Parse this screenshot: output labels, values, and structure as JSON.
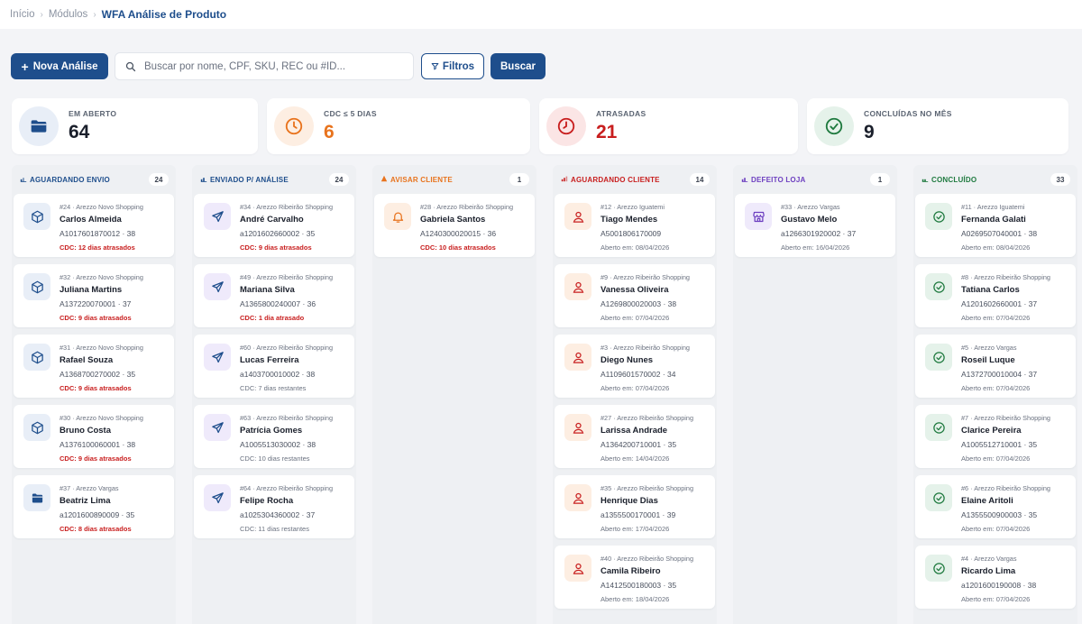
{
  "breadcrumb": {
    "home": "Início",
    "modules": "Módulos",
    "current": "WFA Análise de Produto"
  },
  "toolbar": {
    "new_label": "Nova Análise",
    "search_placeholder": "Buscar por nome, CPF, SKU, REC ou #ID...",
    "filters_label": "Filtros",
    "search_button": "Buscar"
  },
  "stats": [
    {
      "label": "EM ABERTO",
      "value": "64",
      "icon": "folder-icon",
      "color": "#1e4e8c",
      "bg": "#e8eef7"
    },
    {
      "label": "CDC ≤ 5 DIAS",
      "value": "6",
      "icon": "clock-icon",
      "color": "#e8731d",
      "bg": "#fdeee2"
    },
    {
      "label": "ATRASADAS",
      "value": "21",
      "icon": "alarm-icon",
      "color": "#c81e1e",
      "bg": "#fbe5e5"
    },
    {
      "label": "CONCLUÍDAS NO MÊS",
      "value": "9",
      "icon": "check-circle-icon",
      "color": "#1f7a3f",
      "bg": "#e5f2ea"
    }
  ],
  "columns": [
    {
      "title": "AGUARDANDO ENVIO",
      "count": "24",
      "color": "#1e4e8c",
      "icon_bg": "#e8eef7",
      "cards": [
        {
          "meta": "#24 · Arezzo Novo Shopping",
          "name": "Carlos Almeida",
          "code": "A1017601870012 · 38",
          "footer": "CDC: 12 dias atrasados",
          "footer_type": "danger",
          "icon": "box-icon"
        },
        {
          "meta": "#32 · Arezzo Novo Shopping",
          "name": "Juliana Martins",
          "code": "A137220070001 · 37",
          "footer": "CDC: 9 dias atrasados",
          "footer_type": "danger",
          "icon": "box-icon"
        },
        {
          "meta": "#31 · Arezzo Novo Shopping",
          "name": "Rafael Souza",
          "code": "A1368700270002 · 35",
          "footer": "CDC: 9 dias atrasados",
          "footer_type": "danger",
          "icon": "box-icon"
        },
        {
          "meta": "#30 · Arezzo Novo Shopping",
          "name": "Bruno Costa",
          "code": "A1376100060001 · 38",
          "footer": "CDC: 9 dias atrasados",
          "footer_type": "danger",
          "icon": "box-icon"
        },
        {
          "meta": "#37 · Arezzo Vargas",
          "name": "Beatriz Lima",
          "code": "a1201600890009 · 35",
          "footer": "CDC: 8 dias atrasados",
          "footer_type": "danger",
          "icon": "store-icon"
        }
      ]
    },
    {
      "title": "ENVIADO P/ ANÁLISE",
      "count": "24",
      "color": "#1e4e8c",
      "icon_bg": "#efeafb",
      "cards": [
        {
          "meta": "#34 · Arezzo Ribeirão Shopping",
          "name": "André Carvalho",
          "code": "a1201602660002 · 35",
          "footer": "CDC: 9 dias atrasados",
          "footer_type": "danger",
          "icon": "send-icon"
        },
        {
          "meta": "#49 · Arezzo Ribeirão Shopping",
          "name": "Mariana Silva",
          "code": "A1365800240007 · 36",
          "footer": "CDC: 1 dia atrasado",
          "footer_type": "danger",
          "icon": "send-icon"
        },
        {
          "meta": "#60 · Arezzo Ribeirão Shopping",
          "name": "Lucas Ferreira",
          "code": "a1403700010002 · 38",
          "footer": "CDC: 7 dias restantes",
          "footer_type": "muted",
          "icon": "send-icon"
        },
        {
          "meta": "#63 · Arezzo Ribeirão Shopping",
          "name": "Patrícia Gomes",
          "code": "A1005513030002 · 38",
          "footer": "CDC: 10 dias restantes",
          "footer_type": "muted",
          "icon": "send-icon"
        },
        {
          "meta": "#64 · Arezzo Ribeirão Shopping",
          "name": "Felipe Rocha",
          "code": "a1025304360002 · 37",
          "footer": "CDC: 11 dias restantes",
          "footer_type": "muted",
          "icon": "send-icon"
        }
      ]
    },
    {
      "title": "AVISAR CLIENTE",
      "count": "1",
      "color": "#e8731d",
      "icon_bg": "#fdeee2",
      "cards": [
        {
          "meta": "#28 · Arezzo Ribeirão Shopping",
          "name": "Gabriela Santos",
          "code": "A1240300020015 · 36",
          "footer": "CDC: 10 dias atrasados",
          "footer_type": "danger",
          "icon": "bell-icon"
        }
      ]
    },
    {
      "title": "AGUARDANDO CLIENTE",
      "count": "14",
      "color": "#c81e1e",
      "icon_bg": "#fdeee2",
      "cards": [
        {
          "meta": "#12 · Arezzo Iguatemi",
          "name": "Tiago Mendes",
          "code": "A5001806170009",
          "footer": "Aberto em: 08/04/2026",
          "footer_type": "muted",
          "icon": "user-icon"
        },
        {
          "meta": "#9 · Arezzo Ribeirão Shopping",
          "name": "Vanessa Oliveira",
          "code": "A1269800020003 · 38",
          "footer": "Aberto em: 07/04/2026",
          "footer_type": "muted",
          "icon": "user-icon"
        },
        {
          "meta": "#3 · Arezzo Ribeirão Shopping",
          "name": "Diego Nunes",
          "code": "A1109601570002 · 34",
          "footer": "Aberto em: 07/04/2026",
          "footer_type": "muted",
          "icon": "user-icon"
        },
        {
          "meta": "#27 · Arezzo Ribeirão Shopping",
          "name": "Larissa Andrade",
          "code": "A1364200710001 · 35",
          "footer": "Aberto em: 14/04/2026",
          "footer_type": "muted",
          "icon": "user-icon"
        },
        {
          "meta": "#35 · Arezzo Ribeirão Shopping",
          "name": "Henrique Dias",
          "code": "a1355500170001 · 39",
          "footer": "Aberto em: 17/04/2026",
          "footer_type": "muted",
          "icon": "user-icon"
        },
        {
          "meta": "#40 · Arezzo Ribeirão Shopping",
          "name": "Camila Ribeiro",
          "code": "A1412500180003 · 35",
          "footer": "Aberto em: 18/04/2026",
          "footer_type": "muted",
          "icon": "user-icon"
        }
      ]
    },
    {
      "title": "DEFEITO LOJA",
      "count": "1",
      "color": "#6d3fc0",
      "icon_bg": "#efeafb",
      "cards": [
        {
          "meta": "#33 · Arezzo Vargas",
          "name": "Gustavo Melo",
          "code": "a1266301920002 · 37",
          "footer": "Aberto em: 16/04/2026",
          "footer_type": "muted",
          "icon": "shop-icon"
        }
      ]
    },
    {
      "title": "CONCLUÍDO",
      "count": "33",
      "color": "#1f7a3f",
      "icon_bg": "#e5f2ea",
      "cards": [
        {
          "meta": "#11 · Arezzo Iguatemi",
          "name": "Fernanda Galati",
          "code": "A0269507040001 · 38",
          "footer": "Aberto em: 08/04/2026",
          "footer_type": "muted",
          "icon": "check-circle-icon"
        },
        {
          "meta": "#8 · Arezzo Ribeirão Shopping",
          "name": "Tatiana Carlos",
          "code": "A1201602660001 · 37",
          "footer": "Aberto em: 07/04/2026",
          "footer_type": "muted",
          "icon": "check-circle-icon"
        },
        {
          "meta": "#5 · Arezzo Vargas",
          "name": "Roseil Luque",
          "code": "A1372700010004 · 37",
          "footer": "Aberto em: 07/04/2026",
          "footer_type": "muted",
          "icon": "check-circle-icon"
        },
        {
          "meta": "#7 · Arezzo Ribeirão Shopping",
          "name": "Clarice Pereira",
          "code": "A1005512710001 · 35",
          "footer": "Aberto em: 07/04/2026",
          "footer_type": "muted",
          "icon": "check-circle-icon"
        },
        {
          "meta": "#6 · Arezzo Ribeirão Shopping",
          "name": "Elaine Aritoli",
          "code": "A1355500900003 · 35",
          "footer": "Aberto em: 07/04/2026",
          "footer_type": "muted",
          "icon": "check-circle-icon"
        },
        {
          "meta": "#4 · Arezzo Vargas",
          "name": "Ricardo Lima",
          "code": "a1201600190008 · 38",
          "footer": "Aberto em: 07/04/2026",
          "footer_type": "muted",
          "icon": "check-circle-icon"
        }
      ]
    }
  ]
}
